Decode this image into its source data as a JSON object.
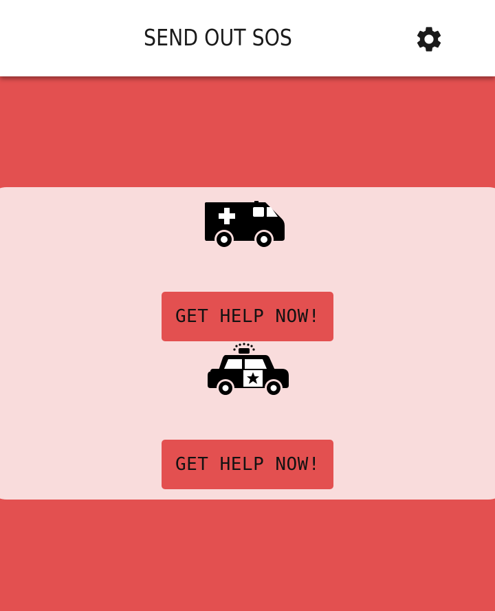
{
  "header": {
    "title": "SEND OUT SOS",
    "settings_icon": "gear-icon"
  },
  "services": [
    {
      "icon": "ambulance-icon",
      "button_label": "GET HELP NOW!"
    },
    {
      "icon": "police-car-icon",
      "button_label": "GET HELP NOW!"
    }
  ],
  "colors": {
    "background": "#e35050",
    "card": "#f9dcdc",
    "button": "#e35050",
    "header": "#ffffff",
    "icon": "#000000"
  }
}
